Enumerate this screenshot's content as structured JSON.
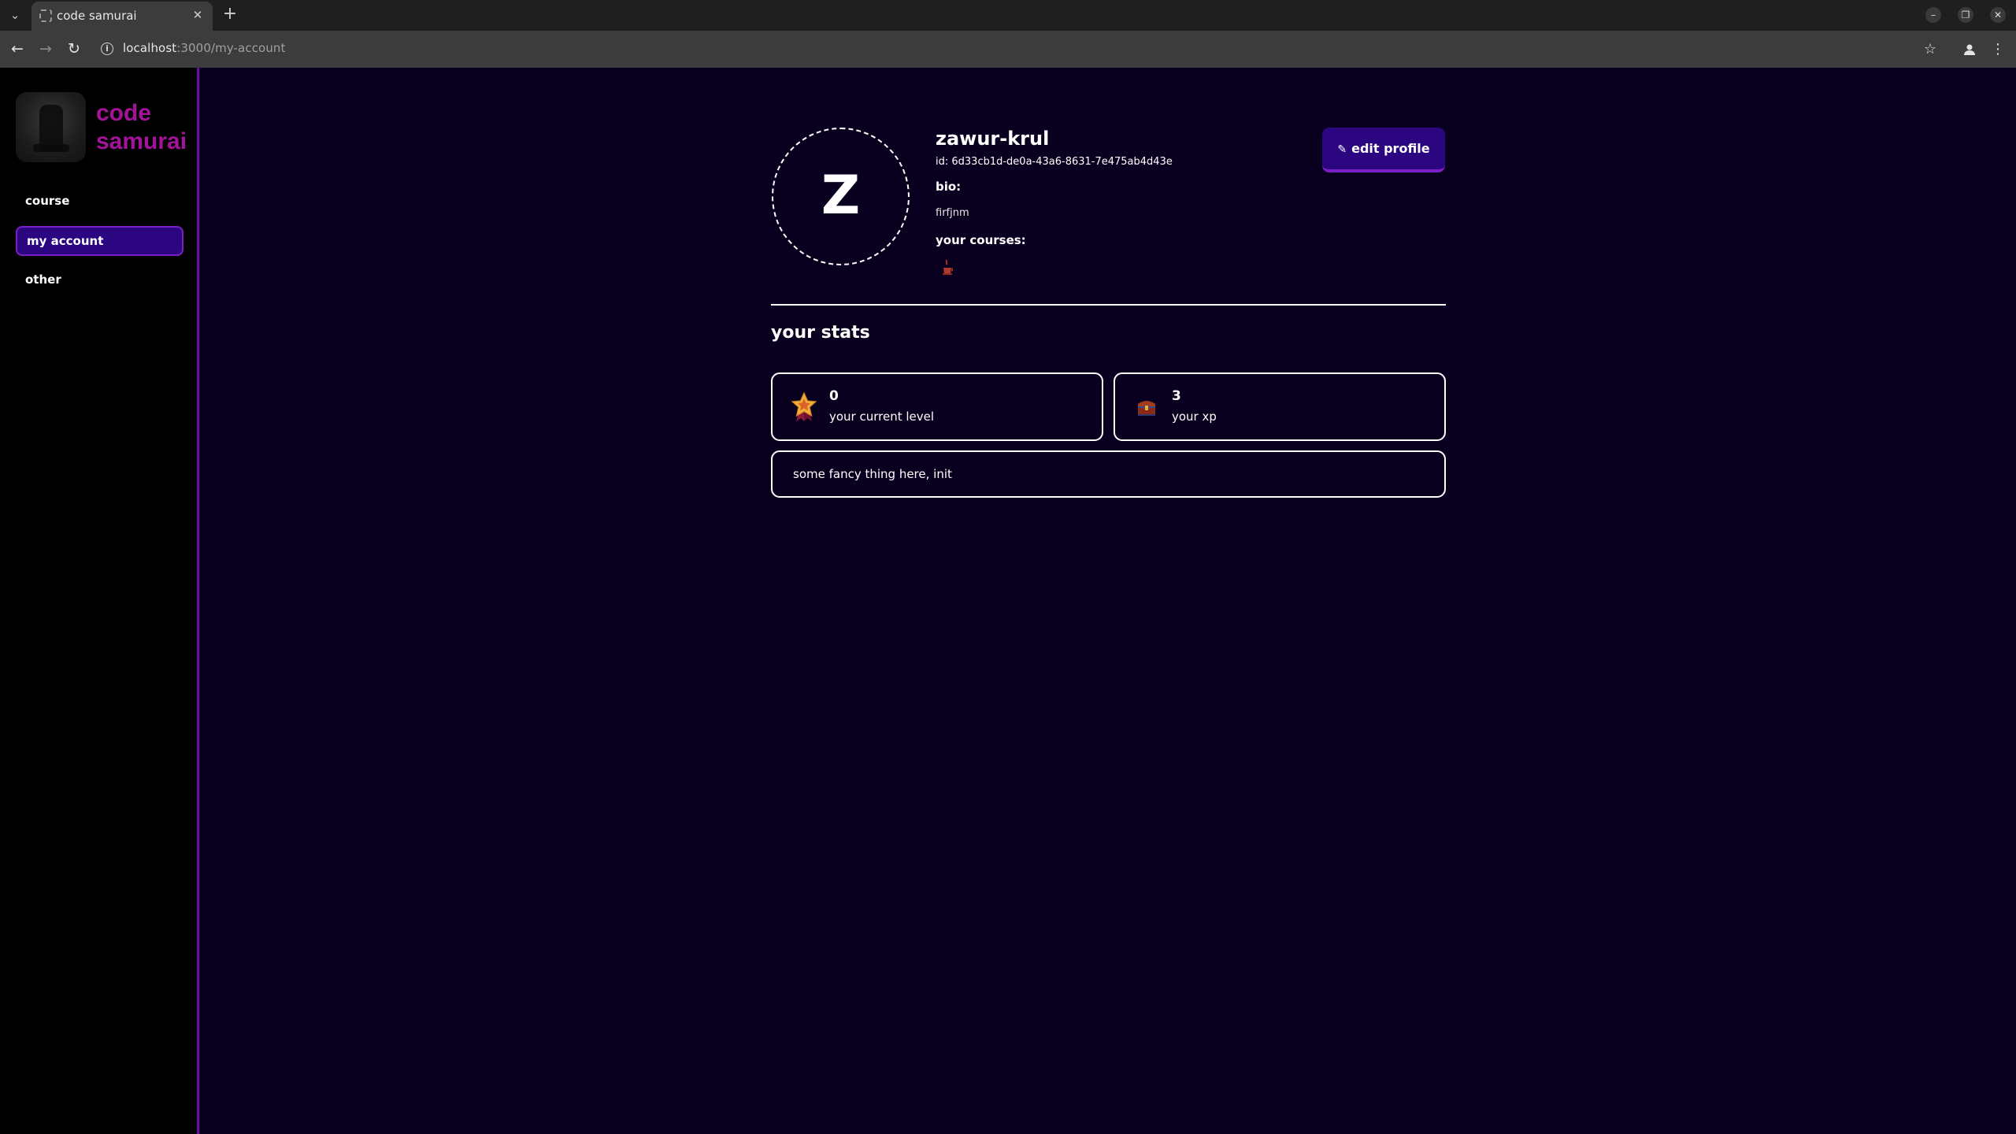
{
  "browser": {
    "tab_title": "code samurai",
    "url_host": "localhost",
    "url_rest": ":3000/my-account"
  },
  "sidebar": {
    "logo_text_line1": "code",
    "logo_text_line2": "samurai",
    "items": [
      {
        "label": "course"
      },
      {
        "label": "my account",
        "active": true
      },
      {
        "label": "other"
      }
    ]
  },
  "profile": {
    "avatar_letter": "Z",
    "username": "zawur-krul",
    "id_text": "id: 6d33cb1d-de0a-43a6-8631-7e475ab4d43e",
    "bio_label": "bio:",
    "bio_value": "firfjnm",
    "courses_label": "your courses:",
    "edit_button_label": "edit profile"
  },
  "stats": {
    "title": "your stats",
    "level": {
      "value": "0",
      "label": "your current level"
    },
    "xp": {
      "value": "3",
      "label": "your xp"
    },
    "fancy_text": "some fancy thing here, init"
  },
  "colors": {
    "app_bg": "#09001f",
    "sidebar_bg": "#000000",
    "accent": "#a5139b",
    "active_nav_bg": "#2c0680",
    "active_nav_border": "#7c1fc6"
  }
}
